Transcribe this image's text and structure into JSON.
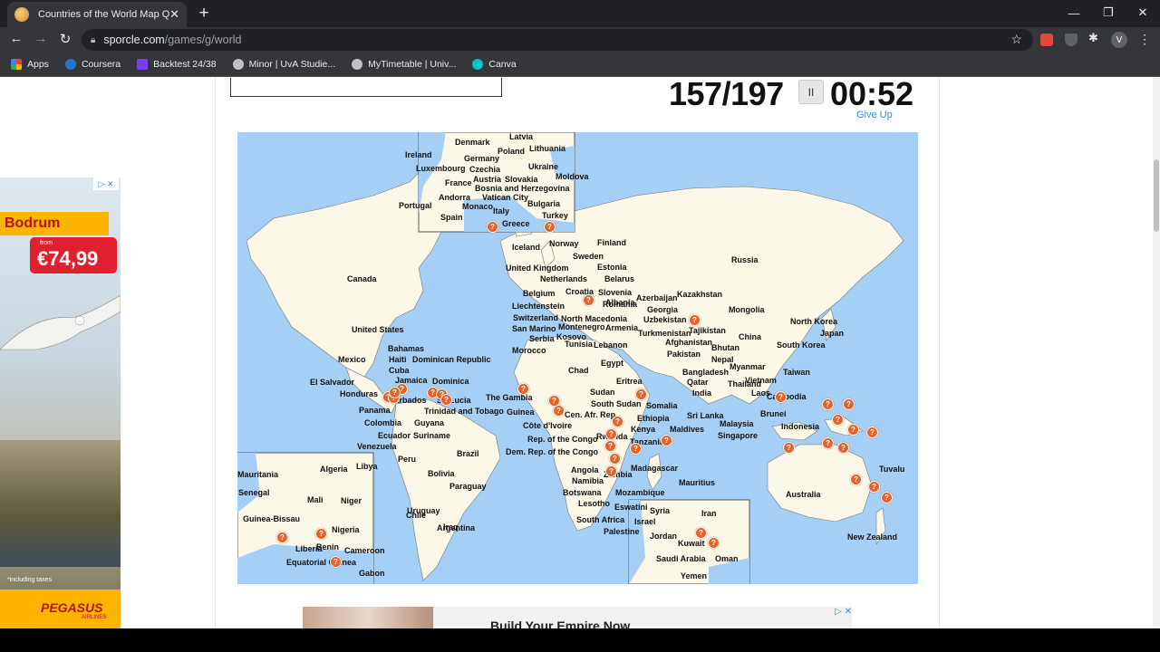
{
  "browser": {
    "tab_title": "Countries of the World Map Quiz",
    "tab_close": "✕",
    "new_tab": "+",
    "url_host": "sporcle.com",
    "url_path": "/games/g/world",
    "avatar_letter": "V",
    "window_controls": [
      "—",
      "❐",
      "✕"
    ],
    "bookmarks": [
      {
        "label": "Apps",
        "color": "#4285f4"
      },
      {
        "label": "Coursera",
        "color": "#2a73cc"
      },
      {
        "label": "Backtest 24/38",
        "color": "#7a3ff2"
      },
      {
        "label": "Minor | UvA Studie...",
        "color": "#bdc1c6"
      },
      {
        "label": "MyTimetable | Univ...",
        "color": "#bdc1c6"
      },
      {
        "label": "Canva",
        "color": "#00c4cc"
      }
    ]
  },
  "quiz": {
    "score": "157/197",
    "timer": "00:52",
    "pause_symbol": "II",
    "give_up": "Give Up"
  },
  "map_labels": [
    "Latvia",
    "Denmark",
    "Lithuania",
    "Ireland",
    "Poland",
    "Germany",
    "Ukraine",
    "Luxembourg",
    "Czechia",
    "Moldova",
    "France",
    "Austria",
    "Slovakia",
    "Bosnia and Herzegovina",
    "Portugal",
    "Andorra",
    "Vatican City",
    "Bulgaria",
    "Monaco",
    "Italy",
    "Turkey",
    "Spain",
    "Greece",
    "Iceland",
    "Norway",
    "Finland",
    "Sweden",
    "Russia",
    "United Kingdom",
    "Estonia",
    "Canada",
    "Netherlands",
    "Belarus",
    "Belgium",
    "Croatia",
    "Slovenia",
    "Kazakhstan",
    "Azerbaijan",
    "Liechtenstein",
    "Albania",
    "Georgia",
    "Mongolia",
    "Switzerland",
    "Romania",
    "North Macedonia",
    "Uzbekistan",
    "North Korea",
    "San Marino",
    "Montenegro",
    "Armenia",
    "Tajikistan",
    "United States",
    "Serbia",
    "Kosovo",
    "Turkmenistan",
    "Japan",
    "South Korea",
    "Tunisia",
    "Lebanon",
    "China",
    "Afghanistan",
    "Bahamas",
    "Morocco",
    "Bhutan",
    "Pakistan",
    "Mexico",
    "Haiti",
    "Dominican Republic",
    "Nepal",
    "Cuba",
    "Egypt",
    "Myanmar",
    "Bangladesh",
    "Chad",
    "Taiwan",
    "El Salvador",
    "Jamaica",
    "Dominica",
    "Vietnam",
    "Qatar",
    "Thailand",
    "Honduras",
    "Eritrea",
    "Laos",
    "Cambodia",
    "Sudan",
    "Barbados",
    "St. Lucia",
    "The Gambia",
    "India",
    "South Sudan",
    "Somalia",
    "Panama",
    "Trinidad and Tobago",
    "Guinea",
    "Brunei",
    "Sri Lanka",
    "Cen. Afr. Rep.",
    "Ethiopia",
    "Colombia",
    "Guyana",
    "Côte d'Ivoire",
    "Malaysia",
    "Indonesia",
    "Kenya",
    "Maldives",
    "Ecuador",
    "Suriname",
    "Singapore",
    "Rep. of the Congo",
    "Venezuela",
    "Tanzania",
    "Rwanda",
    "Dem. Rep. of the Congo",
    "Brazil",
    "Peru",
    "Madagascar",
    "Tuvalu",
    "Algeria",
    "Libya",
    "Angola",
    "Mauritania",
    "Zambia",
    "Bolivia",
    "Mauritius",
    "Namibia",
    "Paraguay",
    "Senegal",
    "Botswana",
    "Mozambique",
    "Australia",
    "Mali",
    "Niger",
    "Lesotho",
    "Eswatini",
    "Syria",
    "Uruguay",
    "Iran",
    "Chile",
    "Israel",
    "Iraq",
    "South Africa",
    "Guinea-Bissau",
    "Nigeria",
    "Argentina",
    "Palestine",
    "Jordan",
    "Kuwait",
    "New Zealand",
    "Benin",
    "Liberia",
    "Cameroon",
    "Oman",
    "Saudi Arabia",
    "Equatorial Guinea",
    "Gabon",
    "Yemen"
  ],
  "pin_symbol": "?",
  "left_ad": {
    "title": "Bodrum",
    "from": "from",
    "price": "€74,99",
    "taxes": "*including taxes",
    "brand": "PEGASUS",
    "brand_sub": "AIRLINES",
    "ad_marks": "▷ ✕"
  },
  "bottom_ad": {
    "headline": "Build Your Empire Now",
    "ad_marks": "▷ ✕"
  }
}
